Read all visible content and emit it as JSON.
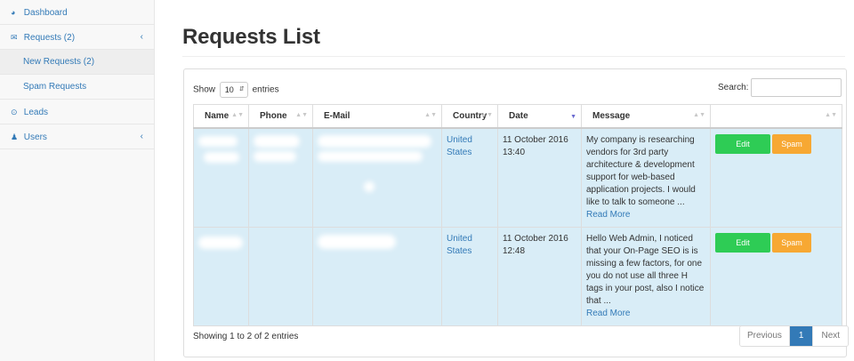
{
  "sidebar": {
    "items": [
      {
        "label": "Dashboard",
        "icon": "dashboard-icon"
      },
      {
        "label": "Requests (2)",
        "icon": "envelope-icon"
      },
      {
        "label": "New Requests (2)"
      },
      {
        "label": "Spam Requests"
      },
      {
        "label": "Leads",
        "icon": "circle-dot-icon"
      },
      {
        "label": "Users",
        "icon": "user-icon"
      }
    ]
  },
  "page": {
    "title": "Requests List"
  },
  "controls": {
    "show_label": "Show",
    "entries_label": "entries",
    "length_value": "10",
    "search_label": "Search:"
  },
  "table": {
    "headers": [
      "Name",
      "Phone",
      "E-Mail",
      "Country",
      "Date",
      "Message",
      ""
    ],
    "rows": [
      {
        "country": "United States",
        "date": "11 October 2016 13:40",
        "message": "My company is researching vendors for 3rd party architecture & development support for web-based application projects. I would like to talk to someone ...",
        "read_more": "Read More",
        "edit": "Edit",
        "spam": "Spam"
      },
      {
        "country": "United States",
        "date": "11 October 2016 12:48",
        "message": "Hello Web Admin, I noticed that your On-Page SEO is is missing a few factors, for one you do not use all three H tags in your post, also I notice that ...",
        "read_more": "Read More",
        "edit": "Edit",
        "spam": "Spam"
      }
    ]
  },
  "footer": {
    "info": "Showing 1 to 2 of 2 entries",
    "prev": "Previous",
    "current_page": "1",
    "next": "Next"
  },
  "colors": {
    "accent": "#337ab7",
    "row_bg": "#d9edf7",
    "edit": "#2ecc55",
    "spam": "#f7a833"
  }
}
